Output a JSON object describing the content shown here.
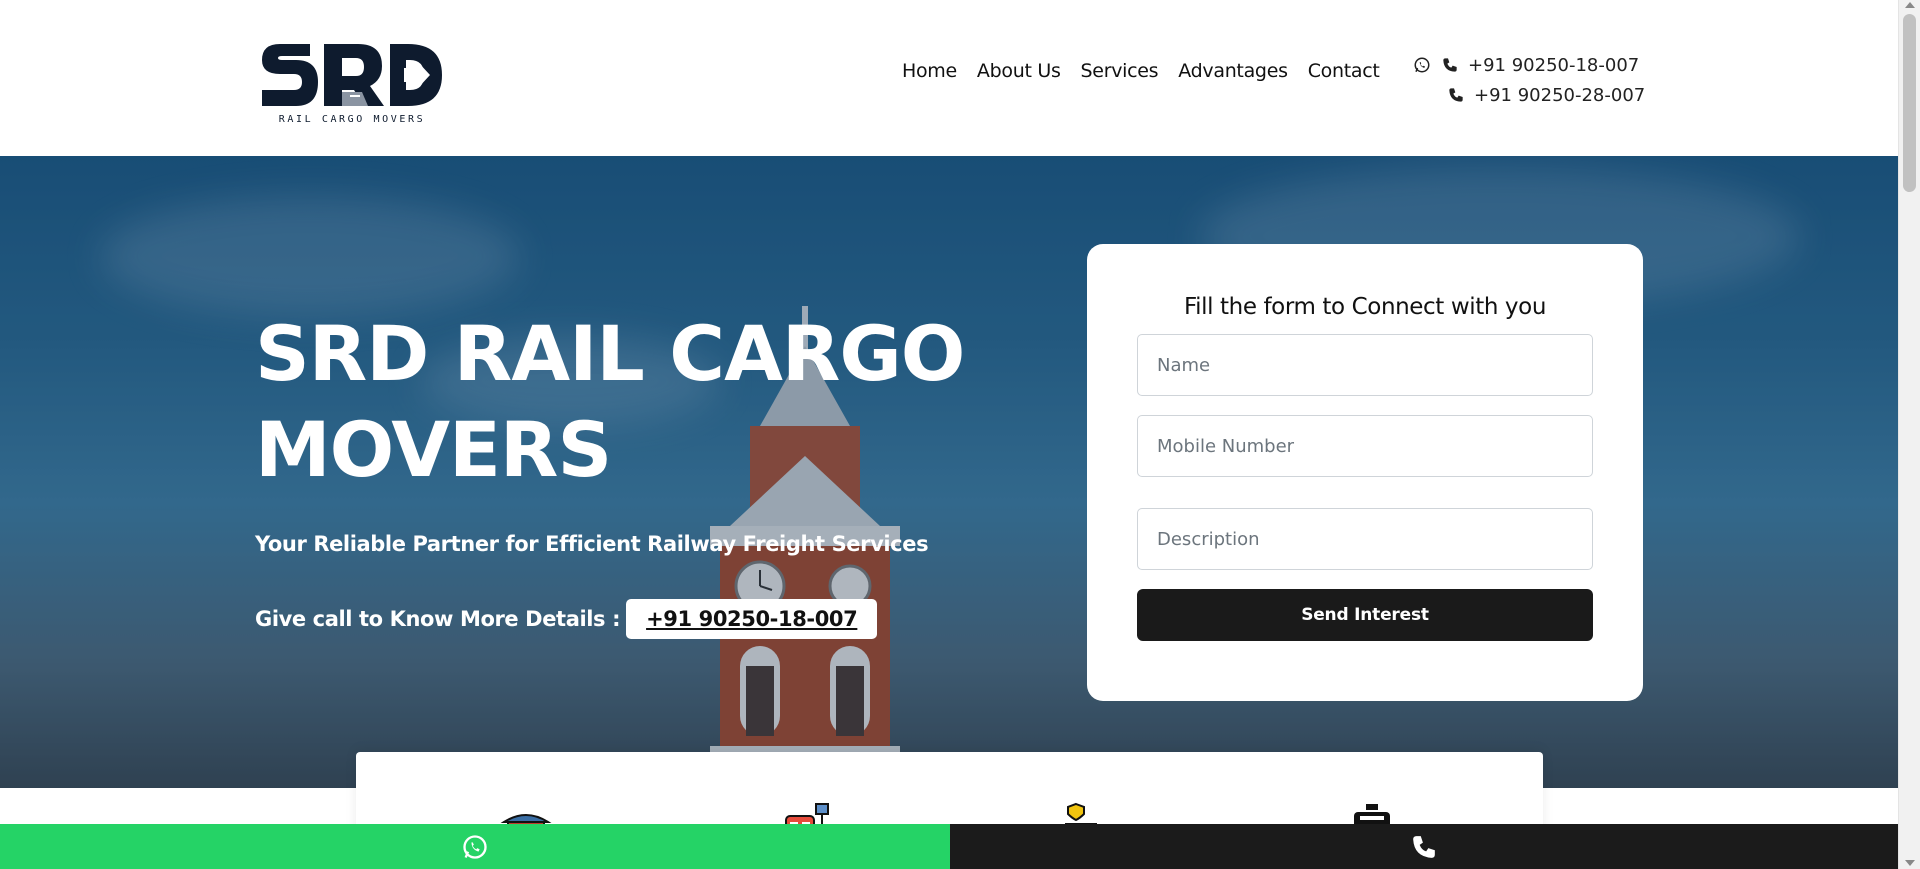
{
  "logo": {
    "letters": "SRD",
    "subtitle": "RAIL CARGO MOVERS"
  },
  "nav": {
    "items": [
      {
        "label": "Home"
      },
      {
        "label": "About Us"
      },
      {
        "label": "Services"
      },
      {
        "label": "Advantages"
      },
      {
        "label": "Contact"
      }
    ]
  },
  "contact": {
    "whatsapp_phone": "+91 90250-18-007",
    "phone": "+91 90250-28-007",
    "icons": [
      "whatsapp-icon",
      "phone-icon"
    ]
  },
  "hero": {
    "title": "SRD RAIL CARGO MOVERS",
    "subtitle": "Your Reliable Partner for Efficient Railway Freight Services",
    "call_label": "Give call to Know More Details :",
    "call_number": "+91 90250-18-007"
  },
  "form": {
    "title": "Fill the form to Connect with you",
    "name_placeholder": "Name",
    "mobile_placeholder": "Mobile Number",
    "description_placeholder": "Description",
    "submit_label": "Send Interest"
  },
  "features": {
    "icons": [
      "railway-station-icon",
      "rail-terminal-icon",
      "cargo-truck-icon",
      "freight-wagon-icon"
    ]
  },
  "bottom_bar": {
    "whatsapp_color": "#25d366",
    "call_color": "#1b1b1b"
  },
  "colors": {
    "brand_dark": "#0e1b2e",
    "button_dark": "#1a1a1a",
    "whatsapp_green": "#25d366"
  }
}
